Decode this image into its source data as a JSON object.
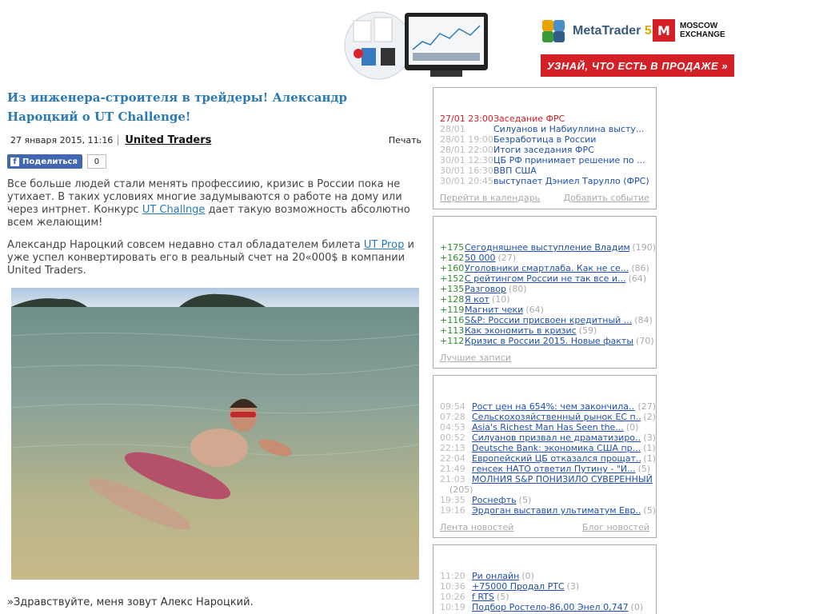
{
  "banner": {
    "metatrader_label": "MetaTrader",
    "metatrader_version": "5",
    "exchange_line1": "MOSCOW",
    "exchange_line2": "EXCHANGE",
    "exchange_mark": "M",
    "promo_text": "УЗНАЙ, ЧТО ЕСТЬ В ПРОДАЖЕ »"
  },
  "article": {
    "title": "Из инженера-строителя в трейдеры! Александр Нароцкий о UT Challenge!",
    "date": "27 января 2015, 11:16",
    "author": "United Traders",
    "print_label": "Печать",
    "share_label": "Поделиться",
    "share_count": "0",
    "p1_before": "Все больше людей стали менять профессиию, кризис в России пока не утихает. В таких условиях многие задумываются о работе на дому или через интрнет. Конкурс ",
    "p1_link": "UT Challnge",
    "p1_after": " дает такую возможность абсолютно всем желающим!",
    "p2_before": "Александр Нароцкий совсем недавно стал обладателем билета ",
    "p2_link": "UT Prop",
    "p2_after": " и уже успел конвертировать его в реальный счет на 20«000$ в компании United Traders.",
    "quote": "»Здравствуйте, меня зовут Алекс Нароцкий."
  },
  "calendar": {
    "events": [
      {
        "time": "27/01 23:00",
        "title": "Заседание ФРС",
        "highlight": true
      },
      {
        "time": "28/01",
        "title": "Силуанов и Набиуллина высту..."
      },
      {
        "time": "28/01 19:00",
        "title": "Безработица в России"
      },
      {
        "time": "28/01 22:00",
        "title": "Итоги заседания ФРС"
      },
      {
        "time": "30/01 12:30",
        "title": "ЦБ РФ принимает решение по ..."
      },
      {
        "time": "30/01 16:30",
        "title": "ВВП США"
      },
      {
        "time": "30/01 20:45",
        "title": "выступает Дэниел Тарулло (ФРС)"
      }
    ],
    "footer_left": "Перейти в календарь",
    "footer_right": "Добавить событие"
  },
  "top_posts": {
    "items": [
      {
        "score": "+175",
        "title": "Сегодняшнее выступление Владими...",
        "count": "(190)"
      },
      {
        "score": "+162",
        "title": "50 000",
        "count": "(27)"
      },
      {
        "score": "+160",
        "title": "Уголовники смартлаба. Как не се...",
        "count": "(86)"
      },
      {
        "score": "+152",
        "title": "С рейтингом России не так все и...",
        "count": "(64)"
      },
      {
        "score": "+135",
        "title": "Разговор",
        "count": "(80)"
      },
      {
        "score": "+128",
        "title": "Я кот",
        "count": "(10)"
      },
      {
        "score": "+119",
        "title": "Магнит чеки",
        "count": "(64)"
      },
      {
        "score": "+116",
        "title": "S&P: России присвоен кредитный ...",
        "count": "(84)"
      },
      {
        "score": "+113",
        "title": "Как экономить в кризис",
        "count": "(59)"
      },
      {
        "score": "+112",
        "title": "Кризис в России 2015. Новые факты",
        "count": "(70)"
      }
    ],
    "footer": "Лучшие записи"
  },
  "news": {
    "items": [
      {
        "time": "09:54",
        "title": "Рост цен на 654%: чем закончила...",
        "count": "(27)"
      },
      {
        "time": "07:28",
        "title": "Сельскохозяйственный рынок ЕС п...",
        "count": "(2)"
      },
      {
        "time": "04:53",
        "title": "Asia's Richest Man Has Seen the...",
        "count": "(0)"
      },
      {
        "time": "00:52",
        "title": "Силуанов призвал не драматизиро...",
        "count": "(3)"
      },
      {
        "time": "22:13",
        "title": "Deutsche Bank: экономика США пр...",
        "count": "(1)"
      },
      {
        "time": "22:04",
        "title": "Европейский ЦБ отказался прощат...",
        "count": "(1)"
      },
      {
        "time": "21:49",
        "title": "генсек НАТО ответил Путину - \"И...",
        "count": "(5)"
      },
      {
        "time": "21:03",
        "title": "МОЛНИЯ S&P ПОНИЗИЛО СУВЕРЕННЫЙ",
        "count": ""
      },
      {
        "time": "",
        "title": "",
        "count": "(205)"
      },
      {
        "time": "19:35",
        "title": "Роснефть",
        "count": "(5)"
      },
      {
        "time": "19:16",
        "title": "Эрдоган выставил ультиматум Евр...",
        "count": "(5)"
      }
    ],
    "footer_left": "Лента новостей",
    "footer_right": "Блог новостей"
  },
  "feed": {
    "items": [
      {
        "time": "11:20",
        "title": "Ри онлайн",
        "count": "(0)"
      },
      {
        "time": "10:36",
        "title": "+75000 Продал РТС",
        "count": "(3)"
      },
      {
        "time": "10:26",
        "title": "f RTS",
        "count": "(5)"
      },
      {
        "time": "10:19",
        "title": "Подбор Ростело-86,00 Энел 0,747",
        "count": "(0)"
      }
    ]
  }
}
